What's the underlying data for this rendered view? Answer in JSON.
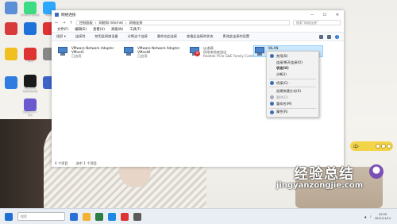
{
  "desktop": {
    "icons": [
      {
        "label": "",
        "color": "#5b8fd6",
        "icon": "recycle-bin-icon"
      },
      {
        "label": "Android Studio",
        "color": "#3ddc84",
        "icon": "android-studio-icon"
      },
      {
        "label": "MuMu",
        "color": "#2ea8ff",
        "icon": "mumu-icon"
      },
      {
        "label": "",
        "color": "#d83b3b",
        "icon": "app-icon"
      },
      {
        "label": "",
        "color": "#1e73d8",
        "icon": "app-icon"
      },
      {
        "label": "",
        "color": "#d33",
        "icon": "app-icon"
      },
      {
        "label": "",
        "color": "#f0c020",
        "icon": "app-icon"
      },
      {
        "label": "WPS",
        "color": "#d33",
        "icon": "wps-icon"
      },
      {
        "label": "",
        "color": "#888",
        "icon": "app-icon"
      },
      {
        "label": "PyCharm Community",
        "color": "#1a1a1a",
        "icon": "pycharm-icon"
      },
      {
        "label": "",
        "color": "#2f7de1",
        "icon": "app-icon"
      },
      {
        "label": "",
        "color": "#3d63c8",
        "icon": "app-icon"
      },
      {
        "label": "Visual C++ 6.0",
        "color": "#6a5acd",
        "icon": "visual-cpp-icon"
      }
    ]
  },
  "window": {
    "title": "网络连接",
    "breadcrumb": [
      "控制面板",
      "网络和 Internet",
      "网络连接"
    ],
    "search_placeholder": "搜索\"网络连接\"",
    "menu": [
      "文件(F)",
      "编辑(E)",
      "查看(V)",
      "高级(N)",
      "工具(T)"
    ],
    "commands": [
      "组织 ▾",
      "连接到",
      "禁用此网络设备",
      "诊断这个连接",
      "重命名此连接",
      "查看此连接的状态",
      "更改此连接的设置"
    ],
    "adapters": [
      {
        "name": "VMware Network Adapter VMnet1",
        "status": "已启用",
        "device": "",
        "disconnected": false,
        "selected": false
      },
      {
        "name": "VMware Network Adapter VMnet8",
        "status": "已启用",
        "device": "",
        "disconnected": false,
        "selected": false
      },
      {
        "name": "以太网",
        "status": "网络电缆被拔出",
        "device": "Realtek PCIe GbE Family Contr...",
        "disconnected": true,
        "selected": false
      },
      {
        "name": "WLAN",
        "status": "",
        "device": "",
        "disconnected": false,
        "selected": true
      }
    ],
    "status": {
      "count": "4 个项目",
      "selected": "选中 1 个项目"
    }
  },
  "context_menu": {
    "items": [
      {
        "label": "禁用(B)",
        "bold": false,
        "disabled": false,
        "icon": true
      },
      {
        "label": "连接/断开连接(O)",
        "bold": false,
        "disabled": false,
        "icon": false
      },
      {
        "label": "状态(U)",
        "bold": true,
        "disabled": false,
        "icon": false
      },
      {
        "label": "诊断(I)",
        "bold": false,
        "disabled": false,
        "icon": false
      },
      {
        "sep": true
      },
      {
        "label": "桥接(G)",
        "bold": false,
        "disabled": false,
        "icon": true
      },
      {
        "sep": true
      },
      {
        "label": "创建快捷方式(S)",
        "bold": false,
        "disabled": false,
        "icon": false
      },
      {
        "label": "删除(D)",
        "bold": false,
        "disabled": true,
        "icon": true
      },
      {
        "label": "重命名(M)",
        "bold": false,
        "disabled": false,
        "icon": true
      },
      {
        "sep": true
      },
      {
        "label": "属性(R)",
        "bold": false,
        "disabled": false,
        "icon": true
      }
    ]
  },
  "widget": {
    "label": "中·"
  },
  "watermark": {
    "brand": "经验总结",
    "url": "jingyanzongjie.com"
  },
  "taskbar": {
    "search_placeholder": "搜索",
    "apps": [
      "#2b6fd6",
      "#f2b233",
      "#2d7d46",
      "#1e88e5",
      "#d33",
      "#5a5a5a"
    ],
    "time": "20:00",
    "date": "2021/11/14"
  }
}
